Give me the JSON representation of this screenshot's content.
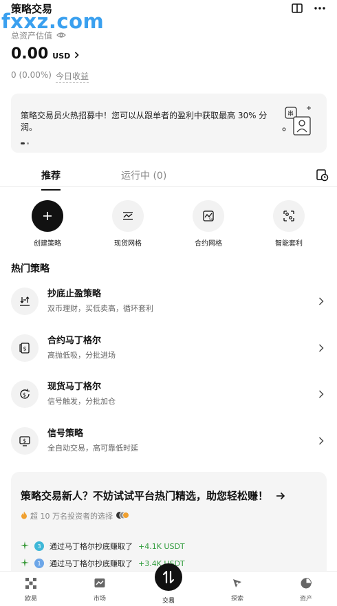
{
  "header": {
    "title": "策略交易",
    "watermark": "fxxz.com"
  },
  "asset": {
    "label": "总资产估值",
    "value": "0.00",
    "currency": "USD",
    "pnl": "0 (0.00%)",
    "today_label": "今日收益"
  },
  "banner": {
    "text": "策略交易员火热招募中！您可以从跟单者的盈利中获取最高 30% 分润。"
  },
  "tabs": [
    {
      "label": "推荐"
    },
    {
      "label": "运行中 (0)"
    }
  ],
  "actions": [
    {
      "label": "创建策略",
      "icon": "plus-icon"
    },
    {
      "label": "现货网格",
      "icon": "spot-grid-icon"
    },
    {
      "label": "合约网格",
      "icon": "futures-grid-icon"
    },
    {
      "label": "智能套利",
      "icon": "arbitrage-icon"
    }
  ],
  "hot_title": "热门策略",
  "strategies": [
    {
      "name": "抄底止盈策略",
      "desc": "双币理财，买低卖高，循环套利",
      "icon": "buy-low-icon"
    },
    {
      "name": "合约马丁格尔",
      "desc": "高抛低吸，分批进场",
      "icon": "futures-martingale-icon"
    },
    {
      "name": "现货马丁格尔",
      "desc": "信号触发，分批加仓",
      "icon": "spot-martingale-icon"
    },
    {
      "name": "信号策略",
      "desc": "全自动交易，高可靠低时延",
      "icon": "signal-icon"
    }
  ],
  "promo": {
    "headline": "策略交易新人？不妨试试平台热门精选，助您轻松赚！",
    "sub": "超 10 万名投资者的选择",
    "rows": [
      {
        "text": "通过马丁格尔抄底赚取了",
        "amount": "+4.1K USDT",
        "badge": "3",
        "badge_color": "#3fb8d8"
      },
      {
        "text": "通过马丁格尔抄底赚取了",
        "amount": "+3.4K USDT",
        "badge": "1",
        "badge_color": "#6ca6e8"
      }
    ]
  },
  "nav": [
    {
      "label": "欧易"
    },
    {
      "label": "市场"
    },
    {
      "label": "交易"
    },
    {
      "label": "探索"
    },
    {
      "label": "资产"
    }
  ]
}
